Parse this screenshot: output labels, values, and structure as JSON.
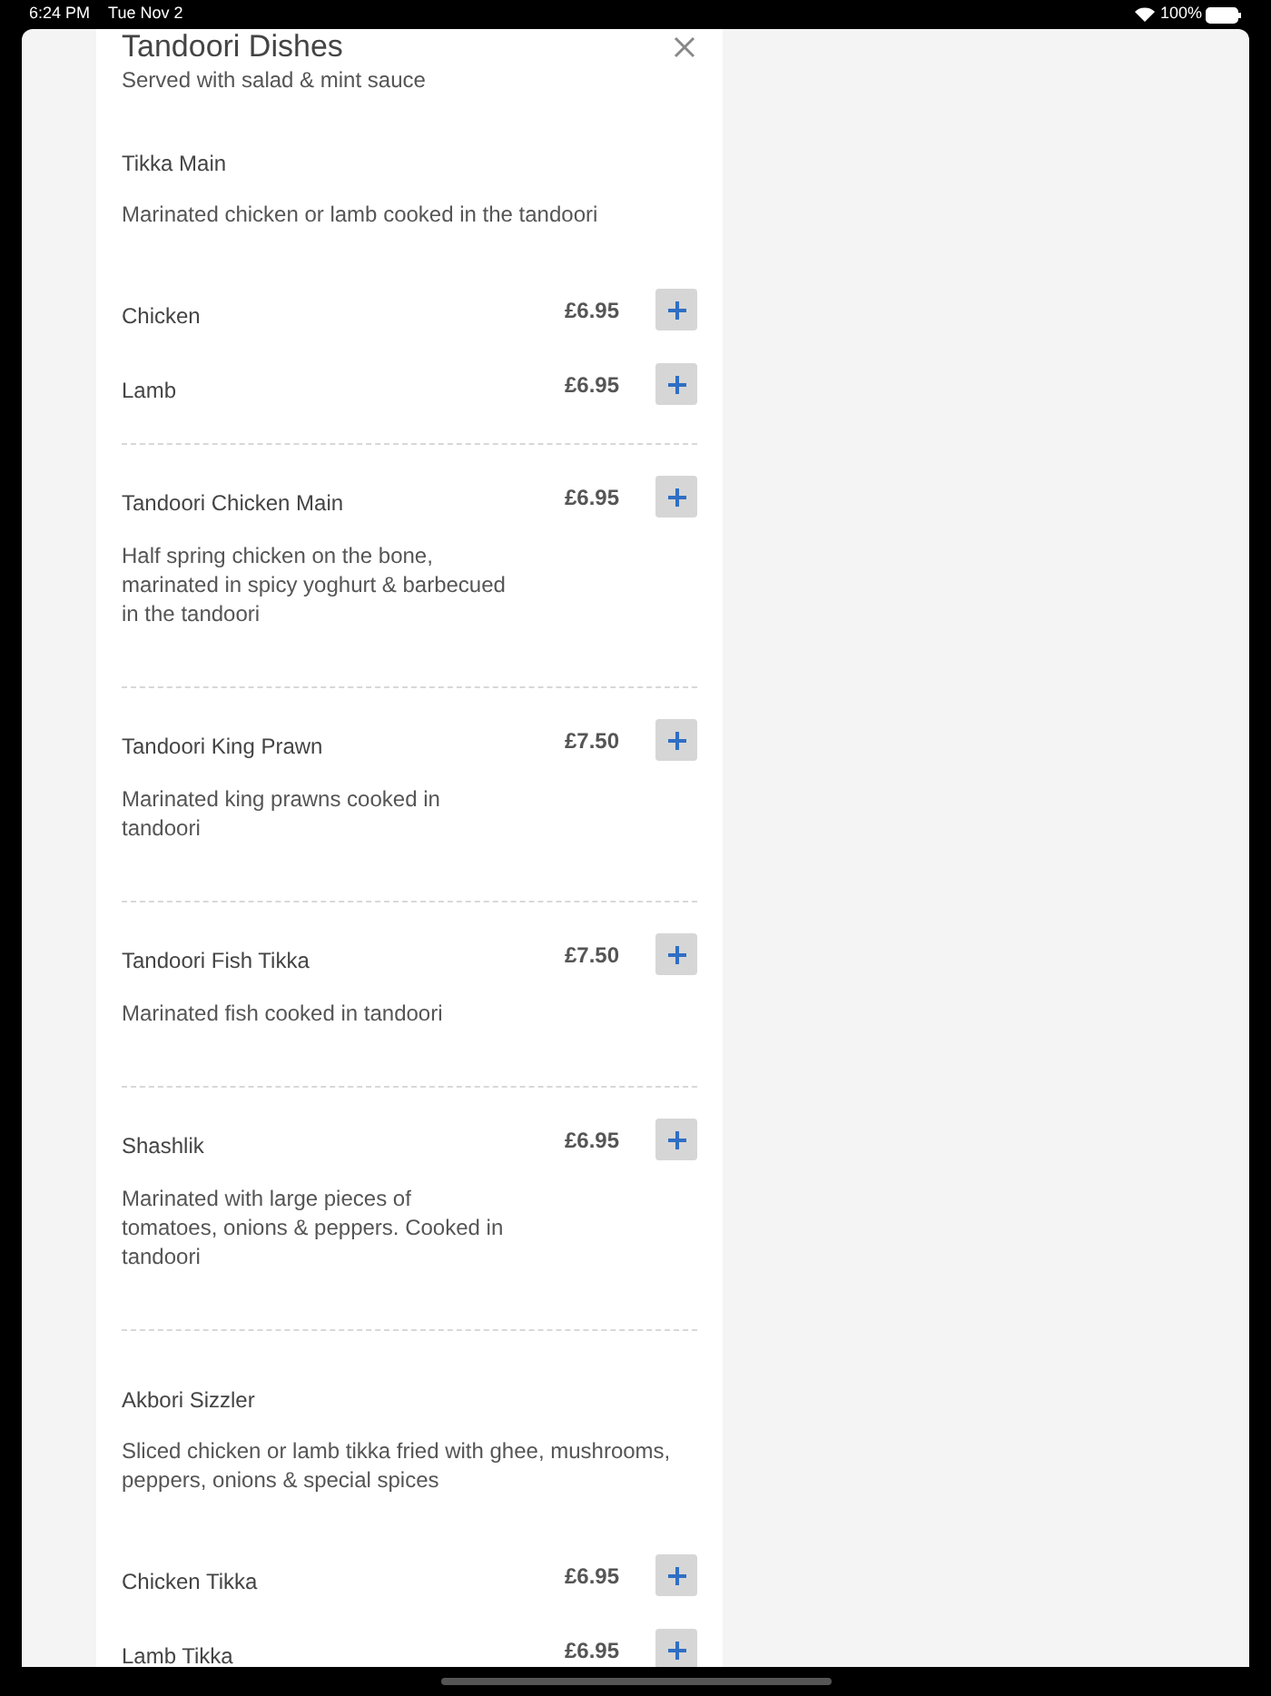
{
  "status_bar": {
    "time": "6:24 PM",
    "date": "Tue Nov 2",
    "battery": "100%"
  },
  "section": {
    "title": "Tandoori Dishes",
    "note": "Served with salad & mint sauce"
  },
  "items": [
    {
      "kind": "group",
      "name": "Tikka Main",
      "description": "Marinated chicken or lamb cooked in the tandoori",
      "options": [
        {
          "name": "Chicken",
          "price": "£6.95"
        },
        {
          "name": "Lamb",
          "price": "£6.95"
        }
      ]
    },
    {
      "kind": "dish",
      "name": "Tandoori Chicken Main",
      "price": "£6.95",
      "description": "Half spring chicken on the bone, marinated in spicy yoghurt & barbecued in the tandoori"
    },
    {
      "kind": "dish",
      "name": "Tandoori King Prawn",
      "price": "£7.50",
      "description": "Marinated king prawns cooked in tandoori"
    },
    {
      "kind": "dish",
      "name": "Tandoori Fish Tikka",
      "price": "£7.50",
      "description": "Marinated fish cooked in tandoori"
    },
    {
      "kind": "dish",
      "name": "Shashlik",
      "price": "£6.95",
      "description": "Marinated with large pieces of tomatoes, onions & peppers. Cooked in tandoori"
    },
    {
      "kind": "group",
      "name": "Akbori Sizzler",
      "description": "Sliced chicken or lamb tikka fried with ghee, mushrooms, peppers, onions & special spices",
      "options": [
        {
          "name": "Chicken Tikka",
          "price": "£6.95"
        },
        {
          "name": "Lamb Tikka",
          "price": "£6.95"
        }
      ]
    }
  ]
}
